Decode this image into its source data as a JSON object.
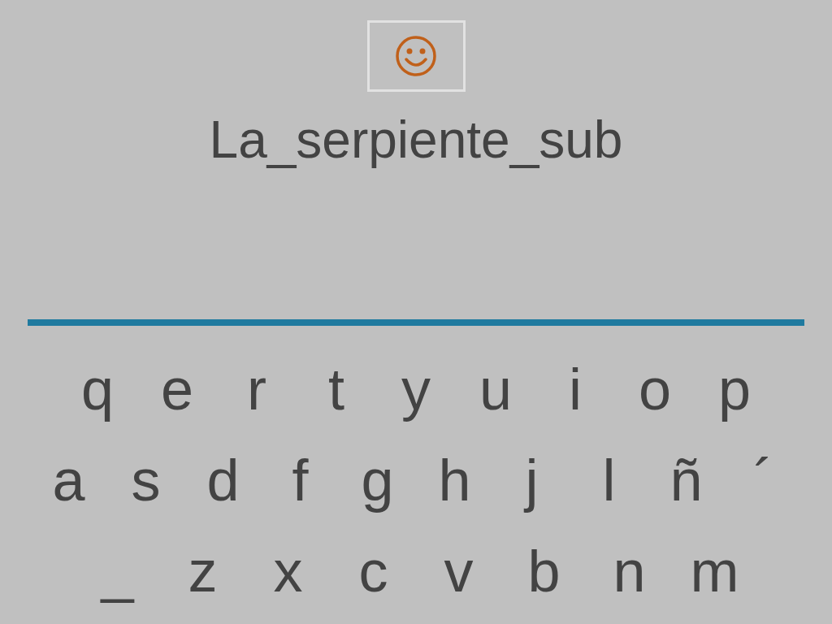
{
  "title": "La_serpiente_sub",
  "keyboard": {
    "rows": [
      [
        "q",
        "e",
        "r",
        "t",
        "y",
        "u",
        "i",
        "o",
        "p"
      ],
      [
        "a",
        "s",
        "d",
        "f",
        "g",
        "h",
        "j",
        "l",
        "ñ",
        "´"
      ],
      [
        "_",
        "z",
        "x",
        "c",
        "v",
        "b",
        "n",
        "m"
      ]
    ]
  }
}
